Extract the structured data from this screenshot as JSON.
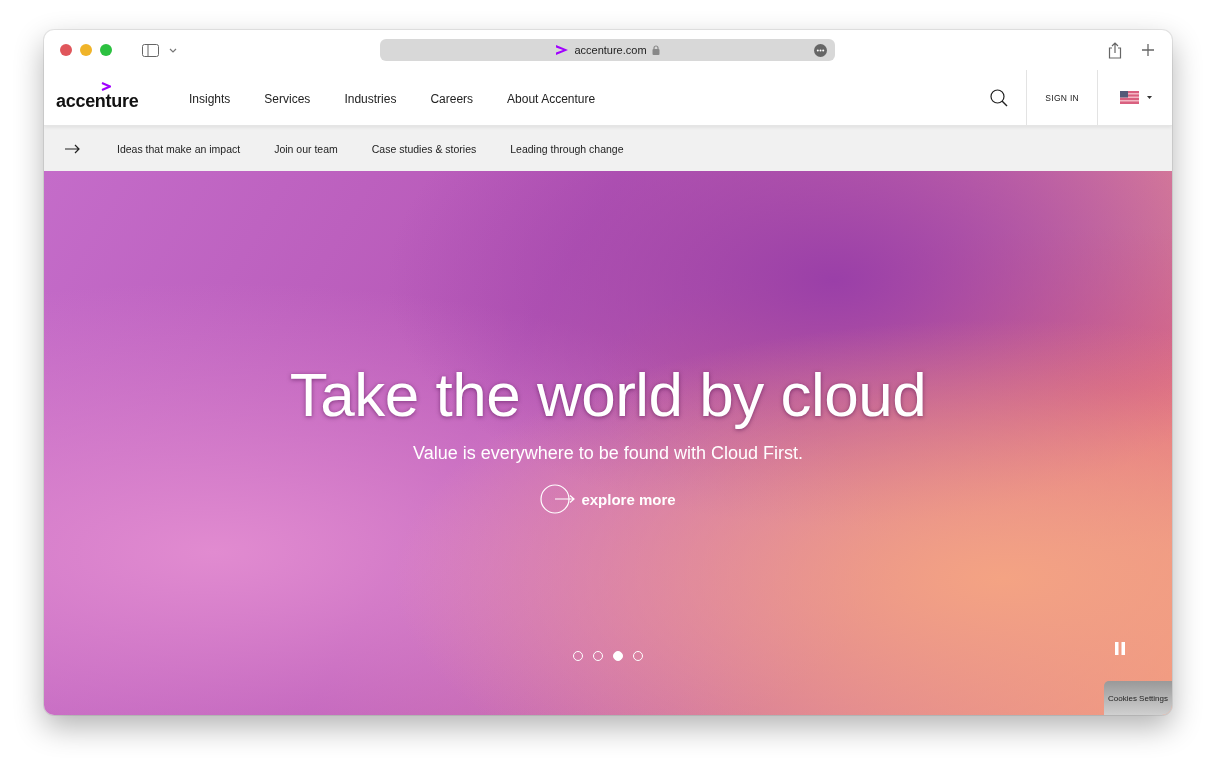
{
  "browser": {
    "url": "accenture.com"
  },
  "site": {
    "logo": "accenture",
    "nav": [
      "Insights",
      "Services",
      "Industries",
      "Careers",
      "About Accenture"
    ],
    "sign_in": "SIGN IN"
  },
  "subnav": [
    "Ideas that make an impact",
    "Join our team",
    "Case studies & stories",
    "Leading through change"
  ],
  "hero": {
    "title": "Take the world by cloud",
    "subtitle": "Value is everywhere to be found with Cloud First.",
    "cta": "explore more",
    "slides": [
      {
        "selected": false
      },
      {
        "selected": false
      },
      {
        "selected": true
      },
      {
        "selected": false
      }
    ]
  },
  "cookies_button": "Cookies Settings"
}
